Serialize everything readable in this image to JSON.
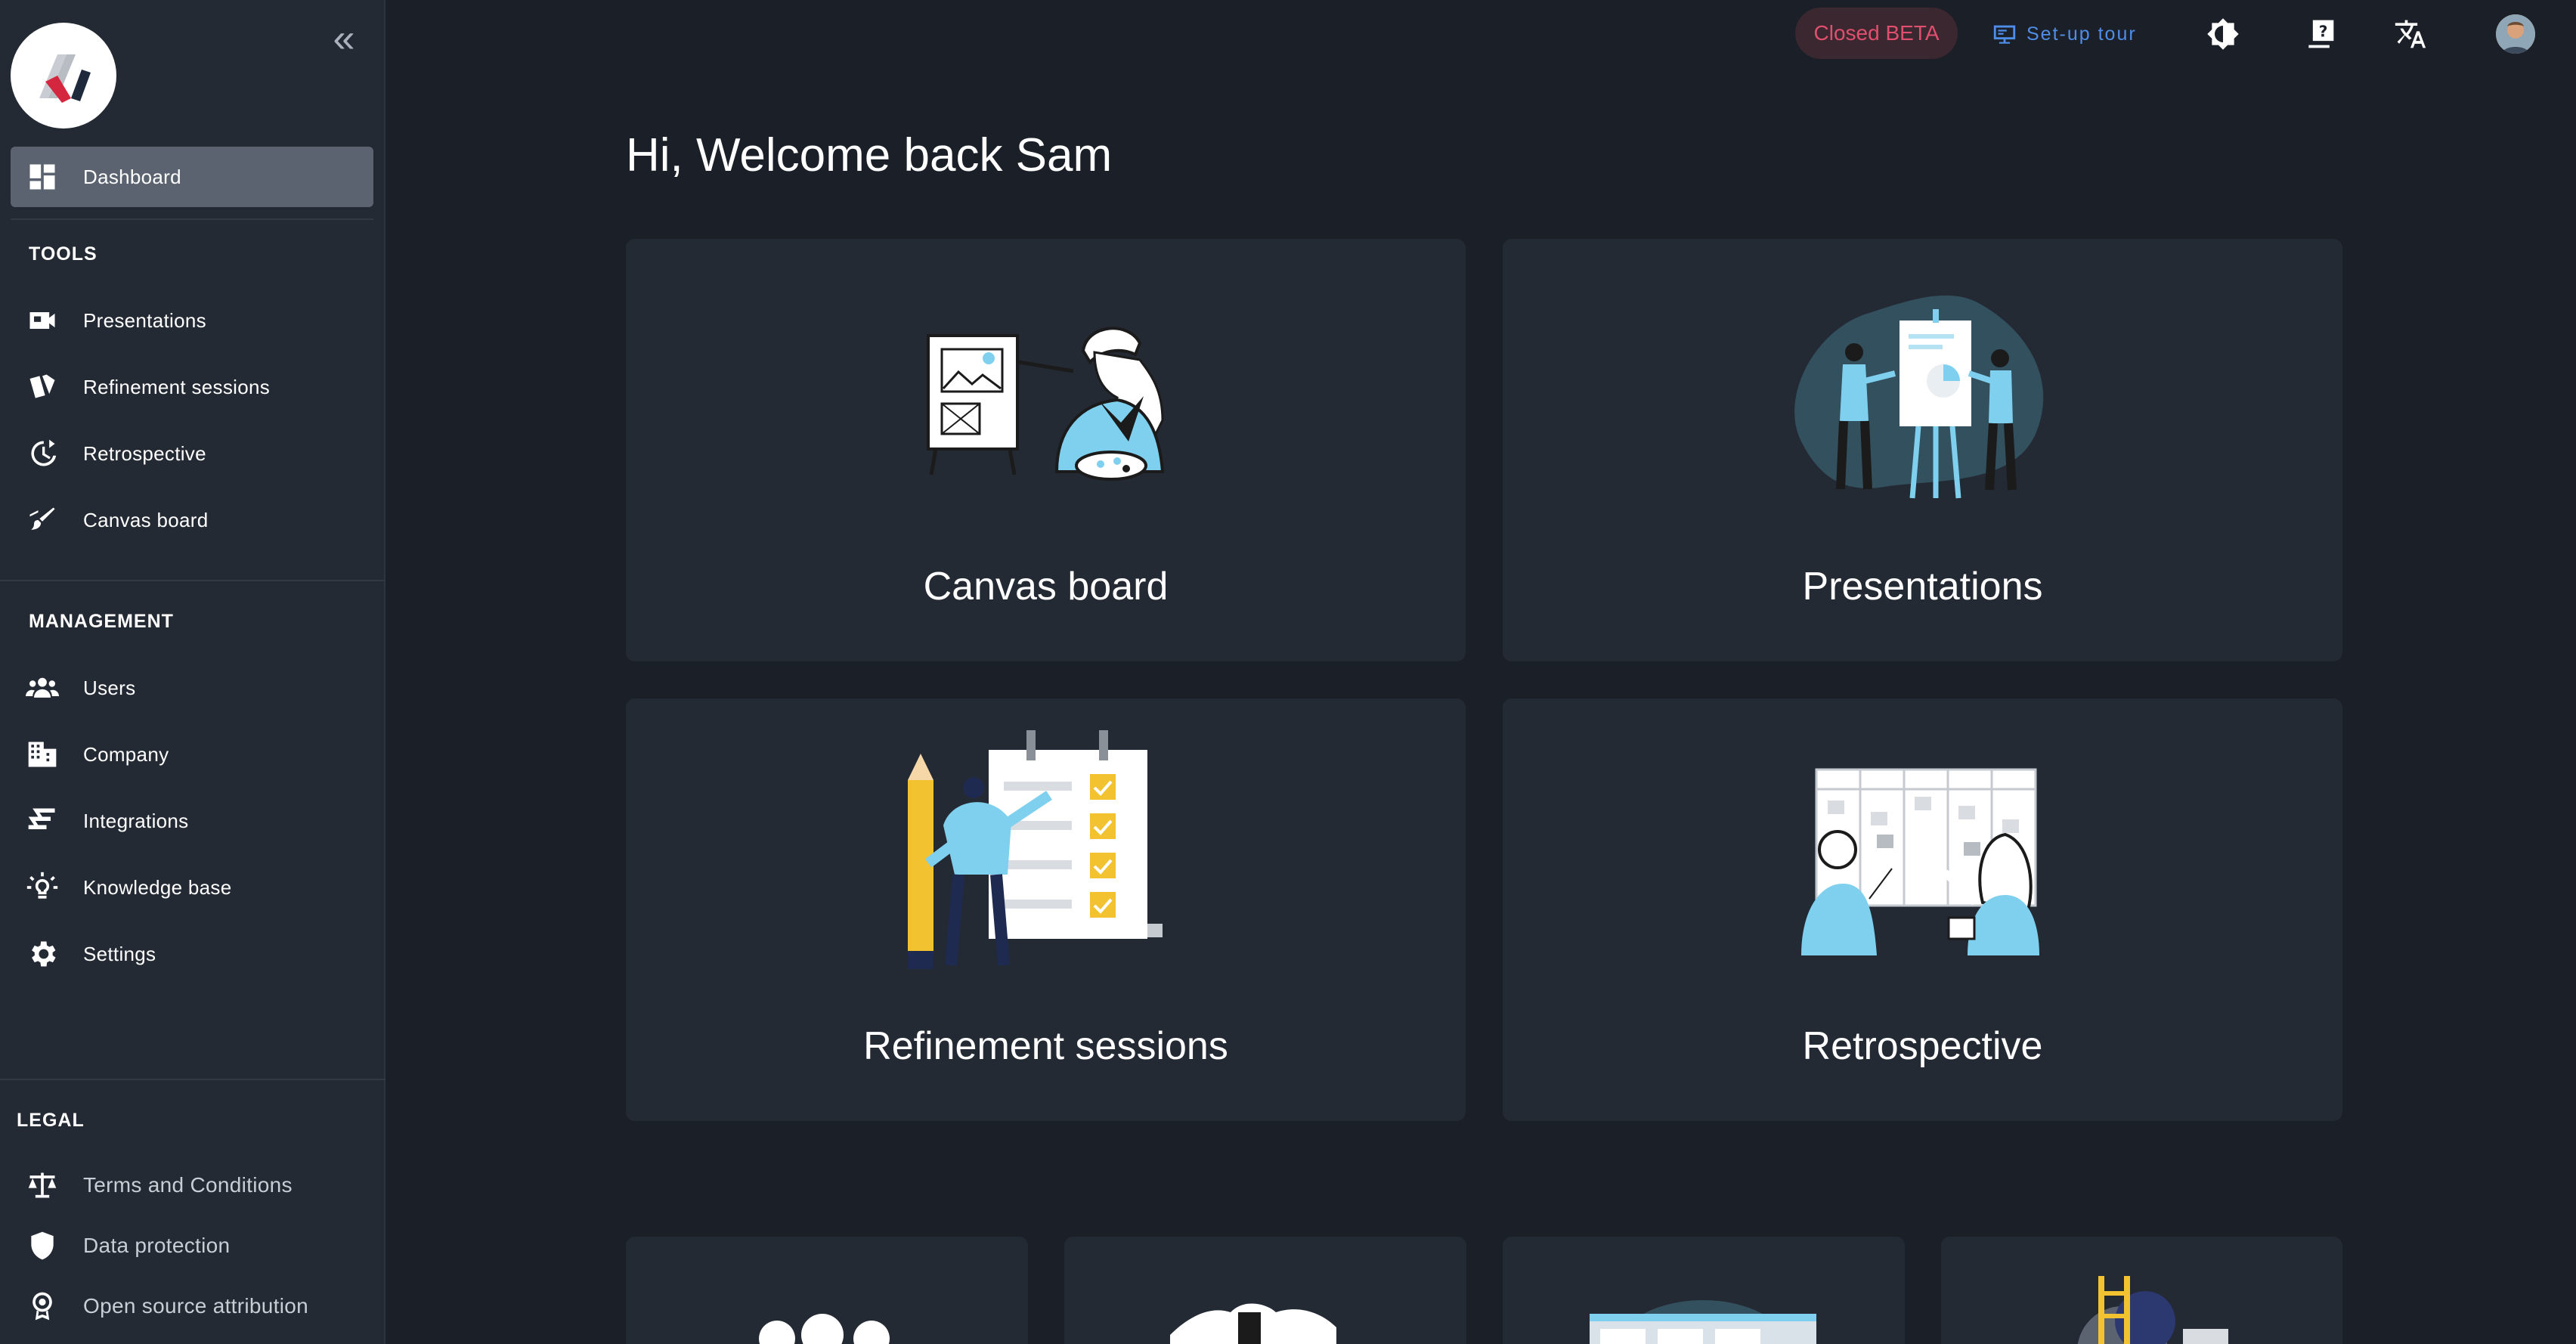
{
  "sidebar": {
    "nav_main": [
      {
        "label": "Dashboard",
        "icon": "dashboard-icon",
        "active": true
      }
    ],
    "tools": {
      "title": "TOOLS",
      "items": [
        {
          "label": "Presentations",
          "icon": "video-camera-icon"
        },
        {
          "label": "Refinement sessions",
          "icon": "cards-icon"
        },
        {
          "label": "Retrospective",
          "icon": "history-icon"
        },
        {
          "label": "Canvas board",
          "icon": "brush-icon"
        }
      ]
    },
    "management": {
      "title": "MANAGEMENT",
      "items": [
        {
          "label": "Users",
          "icon": "users-icon"
        },
        {
          "label": "Company",
          "icon": "building-icon"
        },
        {
          "label": "Integrations",
          "icon": "integrations-icon"
        },
        {
          "label": "Knowledge base",
          "icon": "lightbulb-icon"
        },
        {
          "label": "Settings",
          "icon": "gear-icon"
        }
      ]
    },
    "legal": {
      "title": "LEGAL",
      "items": [
        {
          "label": "Terms and Conditions",
          "icon": "scales-icon"
        },
        {
          "label": "Data protection",
          "icon": "shield-icon"
        },
        {
          "label": "Open source attribution",
          "icon": "award-icon"
        }
      ]
    }
  },
  "topbar": {
    "beta_label": "Closed BETA",
    "tour_label": "Set-up tour"
  },
  "main": {
    "greeting": "Hi, Welcome back Sam",
    "cards": [
      {
        "label": "Canvas board"
      },
      {
        "label": "Presentations"
      },
      {
        "label": "Refinement sessions"
      },
      {
        "label": "Retrospective"
      }
    ]
  },
  "colors": {
    "background": "#1b2028",
    "sidebar": "#242a33",
    "card": "#242a33",
    "active_nav": "#5b6370",
    "beta_text": "#e0506e",
    "tour_text": "#4f8ee8",
    "illustration_accent": "#7fd0ee",
    "checkbox_yellow": "#f2c230"
  }
}
